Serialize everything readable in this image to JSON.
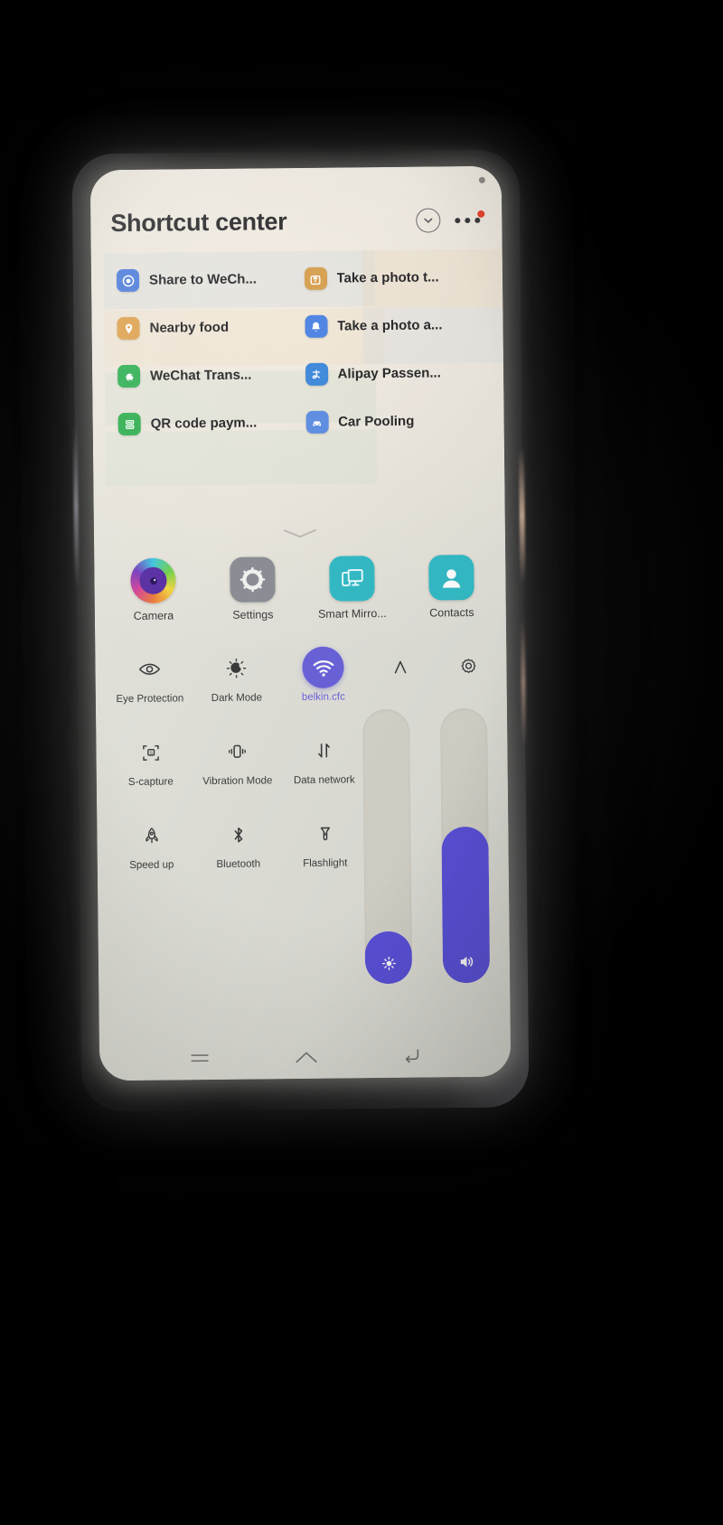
{
  "header": {
    "title": "Shortcut center",
    "collapse_icon": "chevron-down-circle-icon",
    "more_icon": "more-options-icon",
    "badge_color": "#e8402a"
  },
  "shortcuts": [
    {
      "label": "Share to WeCh...",
      "icon": "camera-aperture-icon",
      "color": "#4f7fe0"
    },
    {
      "label": "Take a photo t...",
      "icon": "upload-box-icon",
      "color": "#d9a14f"
    },
    {
      "label": "Nearby food",
      "icon": "location-pin-icon",
      "color": "#e0a44f"
    },
    {
      "label": "Take a photo a...",
      "icon": "bell-icon",
      "color": "#4f86e8"
    },
    {
      "label": "WeChat Trans...",
      "icon": "wechat-transfer-icon",
      "color": "#31b455"
    },
    {
      "label": "Alipay Passen...",
      "icon": "alipay-icon",
      "color": "#3f8ae0"
    },
    {
      "label": "QR code paym...",
      "icon": "qr-code-icon",
      "color": "#2fb250"
    },
    {
      "label": "Car Pooling",
      "icon": "car-icon",
      "color": "#5e8fe6"
    }
  ],
  "apps": [
    {
      "label": "Camera",
      "icon": "camera-app-icon",
      "color": "#7a3fc4"
    },
    {
      "label": "Settings",
      "icon": "gear-app-icon",
      "color": "#8b8e94"
    },
    {
      "label": "Smart Mirro...",
      "icon": "screen-cast-icon",
      "color": "#2ebcc8"
    },
    {
      "label": "Contacts",
      "icon": "contacts-icon",
      "color": "#2ebcc8"
    }
  ],
  "toggles": [
    {
      "label": "Eye Protection",
      "icon": "eye-icon",
      "active": false
    },
    {
      "label": "Dark Mode",
      "icon": "moon-brightness-icon",
      "active": false
    },
    {
      "label": "belkin.cfc",
      "icon": "wifi-icon",
      "active": true
    },
    {
      "label": "S-capture",
      "icon": "screenshot-icon",
      "active": false
    },
    {
      "label": "Vibration Mode",
      "icon": "vibration-icon",
      "active": false
    },
    {
      "label": "Data network",
      "icon": "data-transfer-icon",
      "active": false
    },
    {
      "label": "Speed up",
      "icon": "rocket-icon",
      "active": false
    },
    {
      "label": "Bluetooth",
      "icon": "bluetooth-icon",
      "active": false
    },
    {
      "label": "Flashlight",
      "icon": "flashlight-icon",
      "active": false
    }
  ],
  "toggles_right": [
    {
      "label": "",
      "icon": "font-size-a-icon",
      "active": false
    },
    {
      "label": "",
      "icon": "settings-gear-icon",
      "active": false
    }
  ],
  "sliders": [
    {
      "name": "brightness",
      "icon": "brightness-icon",
      "percent": 19,
      "accent": "#5b50e2"
    },
    {
      "name": "volume",
      "icon": "volume-icon",
      "percent": 57,
      "accent": "#5b50e2"
    }
  ],
  "navbar": [
    {
      "icon": "recents-menu-icon"
    },
    {
      "icon": "home-icon"
    },
    {
      "icon": "back-icon"
    }
  ],
  "accent_color": "#6a62e0",
  "pull_handle_icon": "chevron-down-handle-icon"
}
